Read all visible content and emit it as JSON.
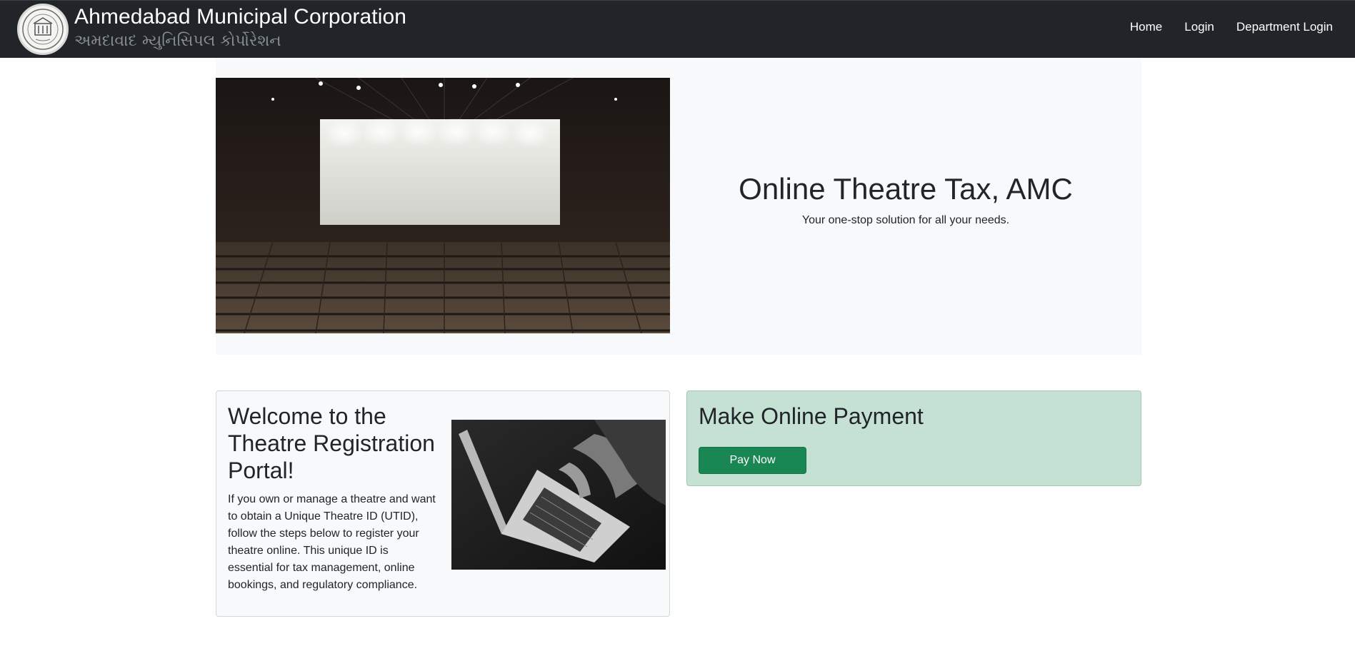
{
  "header": {
    "title": "Ahmedabad Municipal Corporation",
    "subtitle": "અમદાવાદ મ્યુનિસિપલ કોર્પોરેશન",
    "nav": [
      "Home",
      "Login",
      "Department Login"
    ]
  },
  "hero": {
    "title": "Online Theatre Tax, AMC",
    "subtitle": "Your one-stop solution for all your needs."
  },
  "welcome": {
    "title": "Welcome to the Theatre Registration Portal!",
    "text": "If you own or manage a theatre and want to obtain a Unique Theatre ID (UTID), follow the steps below to register your theatre online. This unique ID is essential for tax management, online bookings, and regulatory compliance."
  },
  "payment": {
    "title": "Make Online Payment",
    "button": "Pay Now"
  },
  "colors": {
    "navbar": "#212529",
    "hero_bg": "#f8f9fa",
    "payment_bg": "#c4e1d3",
    "button": "#198754"
  }
}
